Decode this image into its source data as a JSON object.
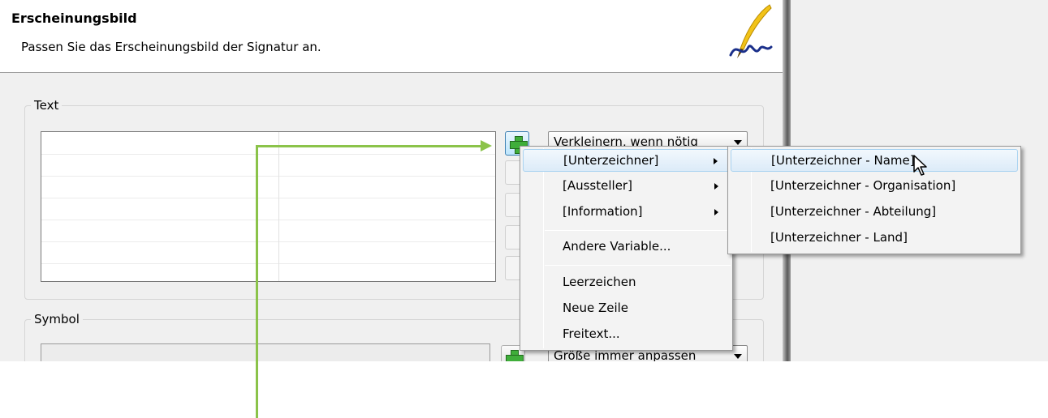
{
  "header": {
    "title": "Erscheinungsbild",
    "subtitle": "Passen Sie das Erscheinungsbild der Signatur an.",
    "logo_icon": "feather-pen-icon"
  },
  "text_group": {
    "legend": "Text",
    "scale_combo_value": "Verkleinern, wenn nötig",
    "add_button_icon": "plus-icon"
  },
  "symbol_group": {
    "legend": "Symbol",
    "size_combo_value": "Größe immer anpassen",
    "add_button_icon": "plus-icon"
  },
  "context_menu": {
    "items": [
      {
        "label": "[Unterzeichner]",
        "has_submenu": true,
        "highlighted": true
      },
      {
        "label": "[Aussteller]",
        "has_submenu": true
      },
      {
        "label": "[Information]",
        "has_submenu": true
      },
      {
        "label": "Andere Variable..."
      },
      {
        "label": "Leerzeichen"
      },
      {
        "label": "Neue Zeile"
      },
      {
        "label": "Freitext..."
      }
    ]
  },
  "submenu": {
    "items": [
      {
        "label": "[Unterzeichner - Name]",
        "highlighted": true
      },
      {
        "label": "[Unterzeichner - Organisation]"
      },
      {
        "label": "[Unterzeichner - Abteilung]"
      },
      {
        "label": "[Unterzeichner - Land]"
      }
    ]
  },
  "colors": {
    "annotation_arrow": "#8bc34a",
    "menu_highlight": "#dcebf8",
    "plus_icon": "#3fae3a"
  }
}
